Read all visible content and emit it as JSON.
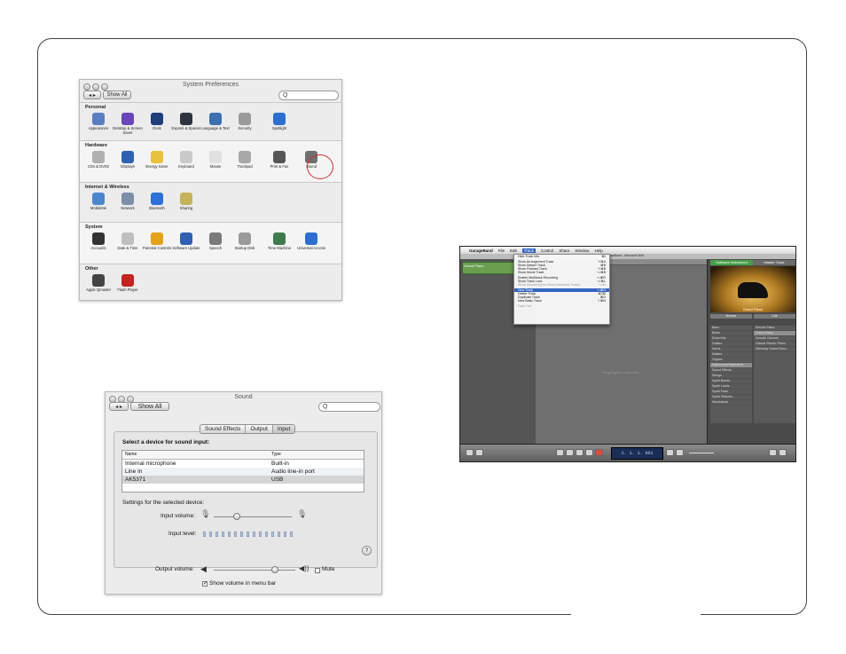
{
  "sysprefs": {
    "title": "System Preferences",
    "show_all": "Show All",
    "search_value": "Q",
    "sections": [
      {
        "label": "Personal",
        "items": [
          {
            "label": "Appearance",
            "icon": "appearance-icon",
            "color": "#5b7fc4"
          },
          {
            "label": "Desktop & Screen Saver",
            "icon": "desktop-icon",
            "color": "#6b46b8"
          },
          {
            "label": "Dock",
            "icon": "dock-icon",
            "color": "#1e3f7a"
          },
          {
            "label": "Exposé & Spaces",
            "icon": "expose-icon",
            "color": "#2e3440"
          },
          {
            "label": "Language & Text",
            "icon": "flag-icon",
            "color": "#3c6fb0"
          },
          {
            "label": "Security",
            "icon": "house-icon",
            "color": "#9a9a9a"
          },
          {
            "label": "Spotlight",
            "icon": "spotlight-icon",
            "color": "#2c6fd1"
          }
        ]
      },
      {
        "label": "Hardware",
        "items": [
          {
            "label": "CDs & DVDs",
            "icon": "cd-icon",
            "color": "#b0b0b0"
          },
          {
            "label": "Displays",
            "icon": "display-icon",
            "color": "#2d62b3"
          },
          {
            "label": "Energy Saver",
            "icon": "bulb-icon",
            "color": "#e7c23b"
          },
          {
            "label": "Keyboard",
            "icon": "keyboard-icon",
            "color": "#c9c9c9"
          },
          {
            "label": "Mouse",
            "icon": "mouse-icon",
            "color": "#e0e0e0"
          },
          {
            "label": "Trackpad",
            "icon": "trackpad-icon",
            "color": "#a8a8a8"
          },
          {
            "label": "Print & Fax",
            "icon": "printer-icon",
            "color": "#555555"
          },
          {
            "label": "Sound",
            "icon": "speaker-icon",
            "color": "#6f6f6f"
          }
        ]
      },
      {
        "label": "Internet & Wireless",
        "items": [
          {
            "label": "MobileMe",
            "icon": "mobileme-icon",
            "color": "#4a86d0"
          },
          {
            "label": "Network",
            "icon": "network-icon",
            "color": "#7d8fa8"
          },
          {
            "label": "Bluetooth",
            "icon": "bluetooth-icon",
            "color": "#2e6fd8"
          },
          {
            "label": "Sharing",
            "icon": "sharing-icon",
            "color": "#c6b25a"
          }
        ]
      },
      {
        "label": "System",
        "items": [
          {
            "label": "Accounts",
            "icon": "accounts-icon",
            "color": "#333333"
          },
          {
            "label": "Date & Time",
            "icon": "clock-icon",
            "color": "#bfbfbf"
          },
          {
            "label": "Parental Controls",
            "icon": "parental-icon",
            "color": "#e2a21a"
          },
          {
            "label": "Software Update",
            "icon": "update-icon",
            "color": "#2f5fb0"
          },
          {
            "label": "Speech",
            "icon": "microphone-icon",
            "color": "#7a7a7a"
          },
          {
            "label": "Startup Disk",
            "icon": "disk-icon",
            "color": "#9a9a9a"
          },
          {
            "label": "Time Machine",
            "icon": "timemachine-icon",
            "color": "#3f7a4e"
          },
          {
            "label": "Universal Access",
            "icon": "access-icon",
            "color": "#2c6fd1"
          }
        ]
      },
      {
        "label": "Other",
        "items": [
          {
            "label": "Apple Qmaster",
            "icon": "qmaster-icon",
            "color": "#444444"
          },
          {
            "label": "Flash Player",
            "icon": "flash-icon",
            "color": "#c4231f"
          }
        ]
      }
    ]
  },
  "sound": {
    "title": "Sound",
    "show_all": "Show All",
    "search_value": "Q",
    "tabs": [
      "Sound Effects",
      "Output",
      "Input"
    ],
    "selected_tab": "Input",
    "heading": "Select a device for sound input:",
    "columns": [
      "Name",
      "Type"
    ],
    "rows": [
      {
        "name": "Internal microphone",
        "type": "Built-in"
      },
      {
        "name": "Line In",
        "type": "Audio line-in port"
      },
      {
        "name": "AK5371",
        "type": "USB"
      }
    ],
    "selected_row": 2,
    "settings_label": "Settings for the selected device:",
    "input_volume_label": "Input volume:",
    "input_level_label": "Input level:",
    "input_volume": 0.3,
    "help_label": "?",
    "output_volume_label": "Output volume:",
    "output_volume": 0.75,
    "mute_label": "Mute",
    "show_volume_label": "Show volume in menu bar",
    "show_volume_checked": true
  },
  "garageband": {
    "menubar": [
      "GarageBand",
      "File",
      "Edit",
      "Track",
      "Control",
      "Share",
      "Window",
      "Help"
    ],
    "active_menu": "Track",
    "window_title": "GarageBand - Microsoft Wolt",
    "track_name": "Grand Piano",
    "menu_items": [
      {
        "label": "Hide Track Info",
        "shortcut": "⌘I",
        "disabled": false
      },
      {
        "sep": true
      },
      {
        "label": "Show Arrangement Track",
        "shortcut": "⇧⌘A",
        "disabled": false
      },
      {
        "label": "Show Master Track",
        "shortcut": "⌘B",
        "disabled": false
      },
      {
        "label": "Show Podcast Track",
        "shortcut": "⇧⌘B",
        "disabled": false
      },
      {
        "label": "Show Movie Track",
        "shortcut": "⌥⌘B",
        "disabled": false
      },
      {
        "sep": true
      },
      {
        "label": "Enable Multitrack Recording",
        "shortcut": "⌥⌘R",
        "disabled": false
      },
      {
        "label": "Show Track Lock",
        "shortcut": "⌥⌘L",
        "disabled": false
      },
      {
        "label": "Show Monitoring for Real Instrument Tracks",
        "shortcut": "⌥⌘I",
        "disabled": true
      },
      {
        "sep": true
      },
      {
        "label": "New Track",
        "shortcut": "⌥⌘N",
        "disabled": false,
        "selected": true
      },
      {
        "label": "Delete Track",
        "shortcut": "⌘⌫",
        "disabled": false
      },
      {
        "label": "Duplicate Track",
        "shortcut": "⌘D",
        "disabled": false
      },
      {
        "label": "New Basic Track",
        "shortcut": "⇧⌘N",
        "disabled": false
      },
      {
        "sep": true
      },
      {
        "label": "Fade Out",
        "shortcut": "",
        "disabled": true
      }
    ],
    "right_tabs": [
      "Software Instrument",
      "Master Track"
    ],
    "instrument": "Grand Piano",
    "browse_buttons": [
      "Browse",
      "Edit"
    ],
    "left_list": [
      "Bass",
      "Brass",
      "Drum Kits",
      "Guitars",
      "Horns",
      "Mallets",
      "Organs",
      "Pianos and Keyboards",
      "Sound Effects",
      "Strings",
      "Synth Basics",
      "Synth Leads",
      "Synth Pads",
      "Synth Textures",
      "Woodwinds"
    ],
    "right_list": [
      "Electric Piano",
      "Grand Piano",
      "Smooth Clavinet",
      "Classic Electric Piano",
      "Steinway Grand Piano"
    ],
    "selected_left": "Pianos and Keyboards",
    "selected_right": "Grand Piano",
    "lcd": "1. 1. 1. 001",
    "timeline_hint": "Drag Apple Loops here."
  }
}
